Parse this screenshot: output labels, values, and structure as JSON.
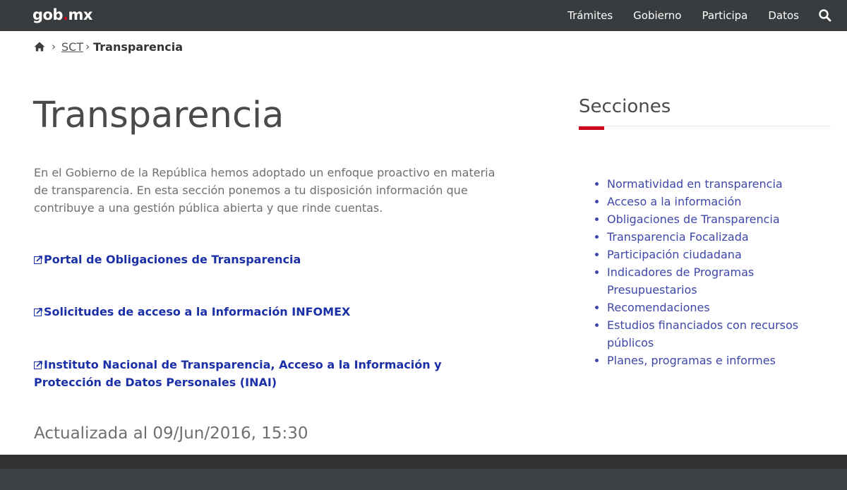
{
  "header": {
    "logo_main": "gob",
    "logo_dot": ".",
    "logo_tail": "mx",
    "nav": [
      "Trámites",
      "Gobierno",
      "Participa",
      "Datos"
    ]
  },
  "breadcrumb": {
    "parent": "SCT",
    "current": "Transparencia"
  },
  "main": {
    "title": "Transparencia",
    "intro": "En el Gobierno de la República hemos adoptado un enfoque proactivo en materia de transparencia. En esta sección ponemos a tu disposición información que contribuye a una gestión pública abierta y que rinde cuentas.",
    "links": [
      "Portal de Obligaciones de Transparencia",
      "Solicitudes de acceso a la Información INFOMEX",
      "Instituto Nacional de Transparencia, Acceso a la Información y Protección de Datos Personales (INAI)"
    ],
    "updated": "Actualizada al 09/Jun/2016, 15:30"
  },
  "sidebar": {
    "title": "Secciones",
    "items": [
      "Normatividad en transparencia",
      "Acceso a la información",
      "Obligaciones de Transparencia",
      "Transparencia Focalizada",
      "Participación ciudadana",
      "Indicadores de Programas Presupuestarios",
      "Recomendaciones",
      "Estudios financiados con recursos públicos",
      "Planes, programas e informes"
    ]
  },
  "colors": {
    "topbar": "#393c3e",
    "accent_red": "#d0021b",
    "link_blue": "#1b2fa6",
    "list_blue": "#3d47a8"
  }
}
